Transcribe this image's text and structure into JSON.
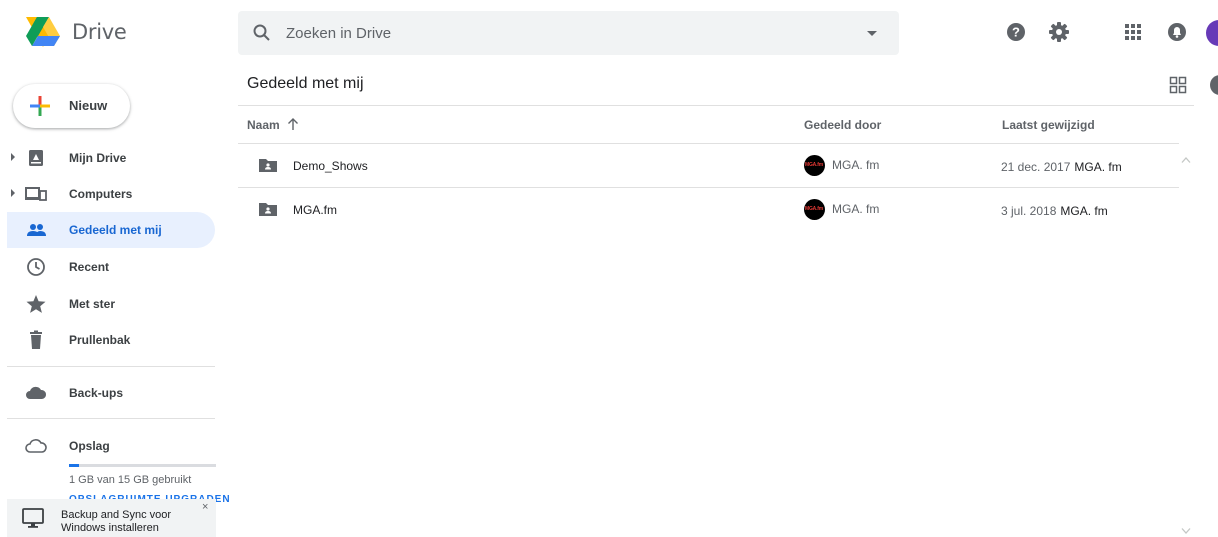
{
  "header": {
    "brand": "Drive",
    "search_placeholder": "Zoeken in Drive"
  },
  "sidebar": {
    "new_label": "Nieuw",
    "items": [
      {
        "label": "Mijn Drive",
        "icon": "my-drive-icon",
        "expandable": true
      },
      {
        "label": "Computers",
        "icon": "computers-icon",
        "expandable": true
      },
      {
        "label": "Gedeeld met mij",
        "icon": "shared-people-icon",
        "active": true
      },
      {
        "label": "Recent",
        "icon": "clock-icon"
      },
      {
        "label": "Met ster",
        "icon": "star-icon"
      },
      {
        "label": "Prullenbak",
        "icon": "trash-icon"
      },
      {
        "label": "Back-ups",
        "icon": "cloud-icon"
      },
      {
        "label": "Opslag",
        "icon": "cloud-outline-icon"
      }
    ],
    "storage_text": "1 GB van 15 GB gebruikt",
    "storage_fraction": 0.067,
    "upgrade_text": "OPSLAGRUIMTE UPGRADEN"
  },
  "backup_banner": {
    "line1": "Backup and Sync voor",
    "line2": "Windows installeren",
    "close": "×"
  },
  "main": {
    "title": "Gedeeld met mij",
    "columns": {
      "name": "Naam",
      "shared_by": "Gedeeld door",
      "modified": "Laatst gewijzigd"
    },
    "rows": [
      {
        "name": "Demo_Shows",
        "owner": "MGA. fm",
        "owner_avatar_text": "MGA.fm",
        "date": "21 dec. 2017",
        "modified_by": "MGA. fm"
      },
      {
        "name": "MGA.fm",
        "owner": "MGA. fm",
        "owner_avatar_text": "MGA.fm",
        "date": "3 jul. 2018",
        "modified_by": "MGA. fm"
      }
    ]
  },
  "colors": {
    "active_bg": "#e8f0fe",
    "active_text": "#1967d2",
    "avatar": "#673ab7",
    "accent_blue": "#1a73e8"
  }
}
